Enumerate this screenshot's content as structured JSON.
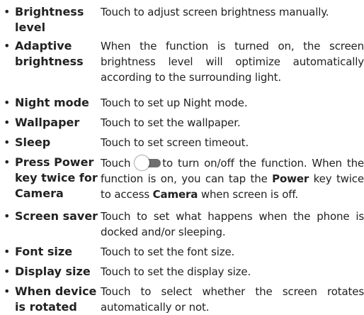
{
  "settings": [
    {
      "term": "Brightness level",
      "description": "Touch to adjust screen brightness manually."
    },
    {
      "term": "Adaptive brightness",
      "description": "When the function is turned on, the screen brightness level will optimize automatically according to the surrounding light."
    },
    {
      "term": "Night mode",
      "description": "Touch to set up Night mode."
    },
    {
      "term": "Wallpaper",
      "description": "Touch to set the wallpaper."
    },
    {
      "term": "Sleep",
      "description": "Touch to set screen timeout."
    },
    {
      "term": "Press Power key twice for Camera",
      "description_parts": {
        "before_switch": "Touch ",
        "switch_icon": "toggle-switch-icon",
        "after_switch": "to turn on/off the function. When the function is on, you can tap the ",
        "bold_1": "Power",
        "middle": " key twice to access ",
        "bold_2": "Camera",
        "end": " when screen is off."
      }
    },
    {
      "term": "Screen saver",
      "description": "Touch to set what happens when the phone is docked and/or sleeping."
    },
    {
      "term": "Font size",
      "description": "Touch to set the font size."
    },
    {
      "term": "Display size",
      "description": "Touch to set the display size."
    },
    {
      "term": "When device is rotated",
      "description": "Touch to select whether the screen rotates automatically or not."
    }
  ]
}
